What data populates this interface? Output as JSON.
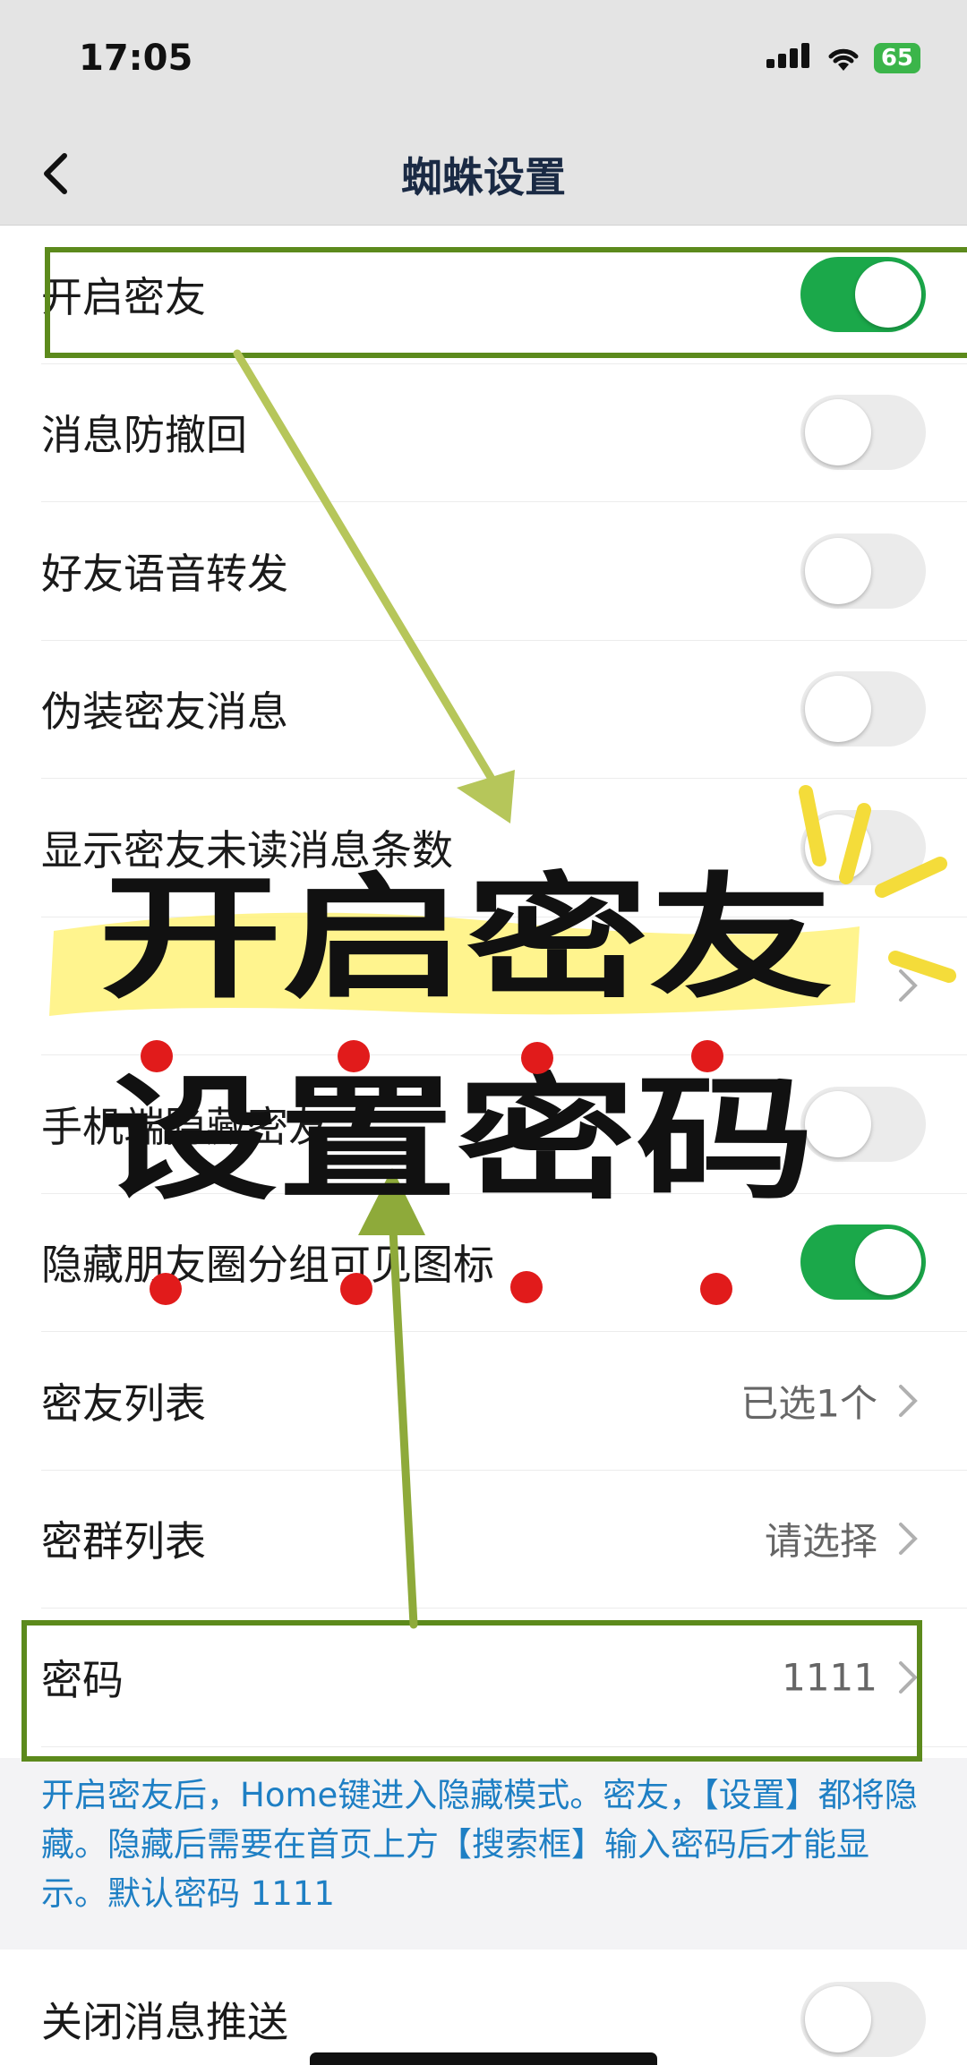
{
  "status_bar": {
    "time": "17:05",
    "battery": "65"
  },
  "nav": {
    "title": "蜘蛛设置"
  },
  "rows": [
    {
      "label": "开启密友",
      "toggle": "on"
    },
    {
      "label": "消息防撤回",
      "toggle": "off"
    },
    {
      "label": "好友语音转发",
      "toggle": "off"
    },
    {
      "label": "伪装密友消息",
      "toggle": "off"
    },
    {
      "label": "显示密友未读消息条数",
      "toggle": "off"
    },
    {
      "label": "",
      "value": ""
    },
    {
      "label": "手机端隐藏密友",
      "toggle": "off"
    },
    {
      "label": "隐藏朋友圈分组可见图标",
      "toggle": "on"
    },
    {
      "label": "密友列表",
      "value": "已选1个"
    },
    {
      "label": "密群列表",
      "value": "请选择"
    },
    {
      "label": "密码",
      "value": "1111"
    }
  ],
  "note": "开启密友后，Home键进入隐藏模式。密友，【设置】都将隐藏。隐藏后需要在首页上方【搜索框】输入密码后才能显示。默认密码 1111",
  "last_row": {
    "label": "关闭消息推送",
    "toggle": "off"
  },
  "overlay_text": {
    "line1": "开启密友",
    "line2": "设置密码"
  },
  "colors": {
    "toggle_on": "#1ba84a",
    "note_text": "#1e7fc4",
    "highlight_box": "#5c8a1c",
    "arrow": "#b6c65a",
    "marker": "#fff27a",
    "dot": "#e11b1b"
  }
}
